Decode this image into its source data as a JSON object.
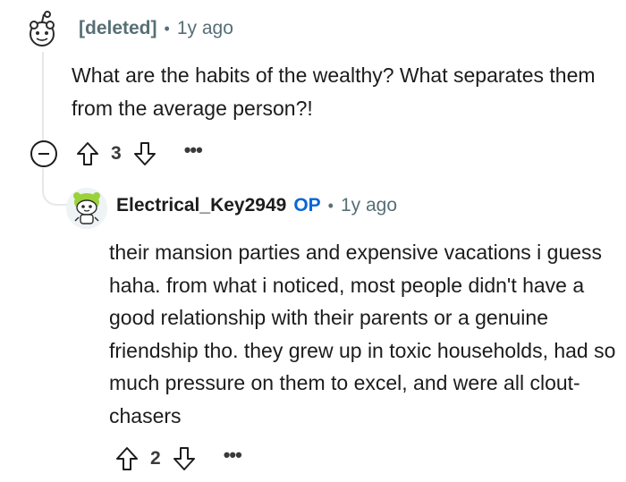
{
  "comment_1": {
    "username": "[deleted]",
    "separator": "•",
    "age": "1y ago",
    "body": "What are the habits of the wealthy? What separates them from the average person?!",
    "score": "3",
    "more": "•••"
  },
  "comment_2": {
    "username": "Electrical_Key2949",
    "op_badge": "OP",
    "separator": "•",
    "age": "1y ago",
    "body": "their mansion parties and expensive vacations i guess haha. from what i noticed, most people didn't have a good relationship with their parents or a genuine friendship tho. they grew up in toxic households, had so much pressure on them to excel, and were all clout-chasers",
    "score": "2",
    "more": "•••"
  },
  "colors": {
    "meta_gray": "#576f76",
    "op_blue": "#0a66d6",
    "thread_line": "#e5e8ea",
    "avatar_green": "#9ad23a"
  },
  "icons": [
    "snoo-avatar-icon",
    "collapse-icon",
    "upvote-icon",
    "downvote-icon",
    "more-options-icon"
  ]
}
